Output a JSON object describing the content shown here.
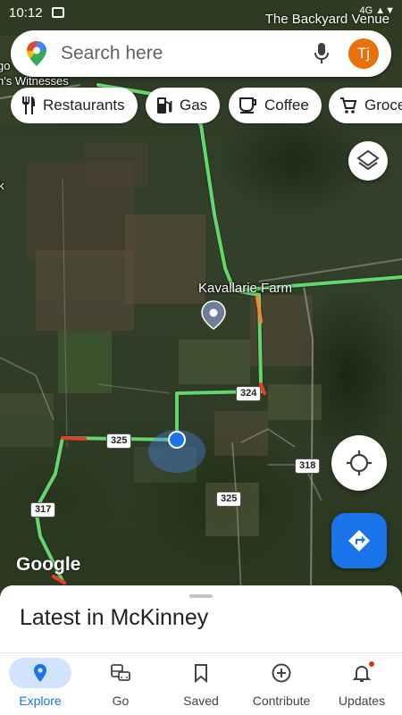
{
  "status_bar": {
    "time": "10:12",
    "right": "4G ▲▼"
  },
  "map": {
    "venue_label": "The Backyard Venue",
    "left_labels": [
      "go",
      "h's Witnesses",
      "k"
    ],
    "farm_label": "Kavallarie Farm",
    "routes": [
      "324",
      "325",
      "318",
      "325",
      "317"
    ],
    "attribution": "Google"
  },
  "search": {
    "placeholder": "Search here",
    "avatar_initials": "Tj"
  },
  "chips": [
    {
      "label": "Restaurants",
      "icon": "restaurant-icon"
    },
    {
      "label": "Gas",
      "icon": "gas-icon"
    },
    {
      "label": "Coffee",
      "icon": "coffee-icon"
    },
    {
      "label": "Groce",
      "icon": "cart-icon"
    }
  ],
  "sheet": {
    "title": "Latest in McKinney"
  },
  "nav": [
    {
      "label": "Explore",
      "icon": "explore-pin-icon",
      "active": true
    },
    {
      "label": "Go",
      "icon": "commute-icon"
    },
    {
      "label": "Saved",
      "icon": "bookmark-icon"
    },
    {
      "label": "Contribute",
      "icon": "add-circle-icon"
    },
    {
      "label": "Updates",
      "icon": "bell-icon",
      "badge": true
    }
  ],
  "colors": {
    "accent": "#1a73e8",
    "avatar": "#e8710a",
    "traffic_green": "#62d86b",
    "traffic_red": "#e0402d"
  }
}
